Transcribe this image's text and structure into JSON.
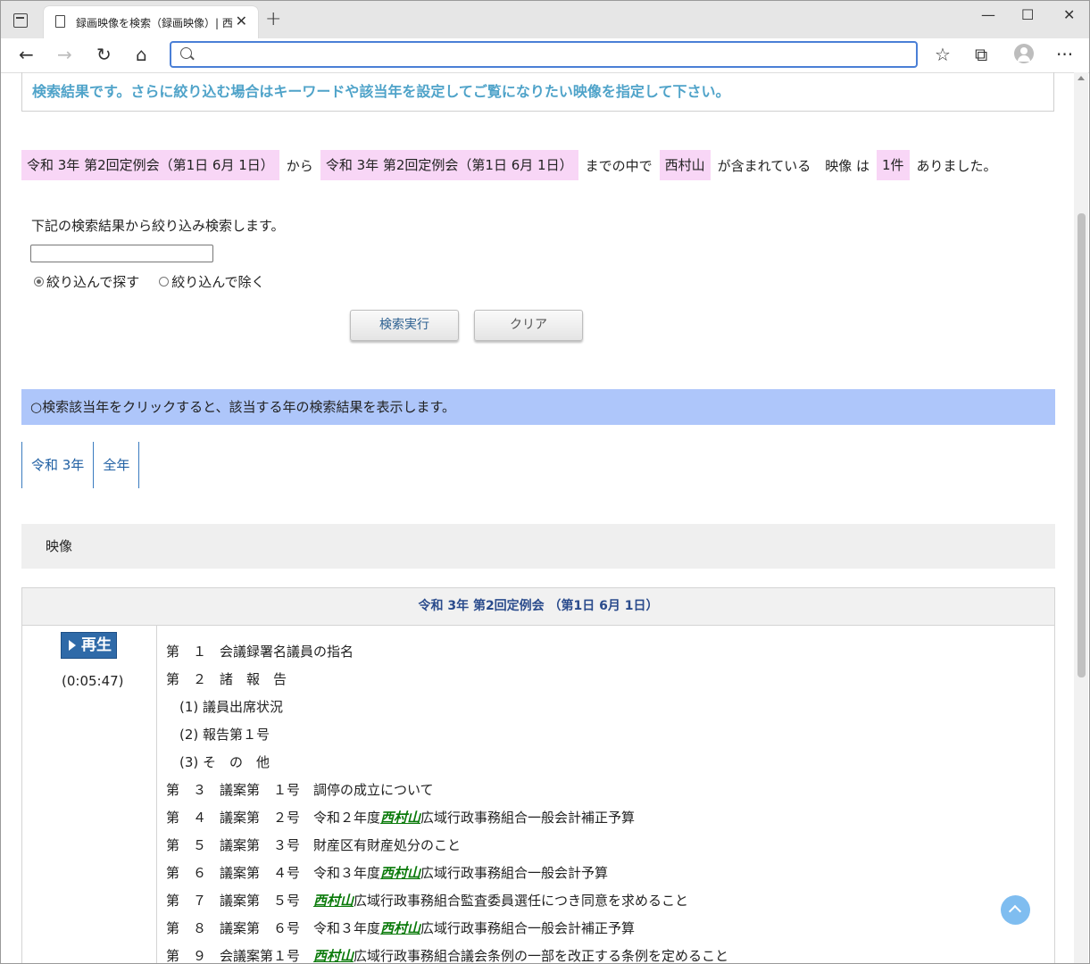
{
  "browser": {
    "tab_title": "録画映像を検索（録画映像）| 西",
    "address_value": "",
    "close_tab": "✕",
    "new_tab": "+",
    "minimize": "—",
    "maximize": "☐",
    "close_window": "✕",
    "back": "←",
    "forward": "→",
    "reload": "↻",
    "home": "⌂",
    "favorites": "☆",
    "collections": "⧉",
    "more": "···"
  },
  "page": {
    "info_message": "検索結果です。さらに絞り込む場合はキーワードや該当年を設定してご覧になりたい映像を指定して下さい。",
    "summary": {
      "from": "令和 3年 第2回定例会（第1日 6月 1日）",
      "from_suffix": "から",
      "to": "令和 3年 第2回定例会（第1日 6月 1日）",
      "to_suffix": "までの中で",
      "keyword": "西村山",
      "keyword_suffix": "が含まれている",
      "type_label": "映像 は",
      "count": "1件",
      "end": "ありました。"
    },
    "refine": {
      "label": "下記の検索結果から絞り込み検索します。",
      "input_value": "",
      "option_include": "絞り込んで探す",
      "option_exclude": "絞り込んで除く",
      "selected": "include",
      "search_button": "検索実行",
      "clear_button": "クリア"
    },
    "year_bar": "○検索該当年をクリックすると、該当する年の検索結果を表示します。",
    "year_links": [
      "令和 3年",
      "全年"
    ],
    "video_section": "映像",
    "result": {
      "title": "令和 3年 第2回定例会 （第1日 6月 1日）",
      "play_label": "再生",
      "duration": "(0:05:47)",
      "agenda": [
        {
          "pre": "第　１　会議録署名議員の指名",
          "kw": "",
          "post": ""
        },
        {
          "pre": "第　２　諸　報　告",
          "kw": "",
          "post": ""
        },
        {
          "pre": "　(1) 議員出席状況",
          "kw": "",
          "post": ""
        },
        {
          "pre": "　(2) 報告第１号",
          "kw": "",
          "post": ""
        },
        {
          "pre": "　(3) そ　の　他",
          "kw": "",
          "post": ""
        },
        {
          "pre": "第　３　議案第　１号　調停の成立について",
          "kw": "",
          "post": ""
        },
        {
          "pre": "第　４　議案第　２号　令和２年度",
          "kw": "西村山",
          "post": "広域行政事務組合一般会計補正予算"
        },
        {
          "pre": "第　５　議案第　３号　財産区有財産処分のこと",
          "kw": "",
          "post": ""
        },
        {
          "pre": "第　６　議案第　４号　令和３年度",
          "kw": "西村山",
          "post": "広域行政事務組合一般会計予算"
        },
        {
          "pre": "第　７　議案第　５号　",
          "kw": "西村山",
          "post": "広域行政事務組合監査委員選任につき同意を求めること"
        },
        {
          "pre": "第　８　議案第　６号　令和３年度",
          "kw": "西村山",
          "post": "広域行政事務組合一般会計補正予算"
        },
        {
          "pre": "第　９　会議案第１号　",
          "kw": "西村山",
          "post": "広域行政事務組合議会条例の一部を改正する条例を定めること"
        }
      ]
    }
  }
}
